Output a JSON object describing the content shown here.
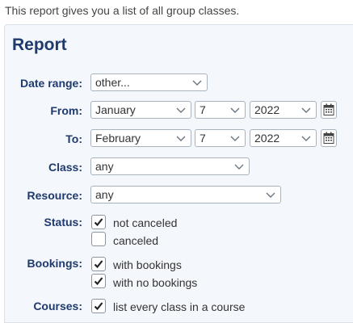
{
  "intro": "This report gives you a list of all group classes.",
  "title": "Report",
  "date_range": {
    "label": "Date range:",
    "value": "other..."
  },
  "from": {
    "label": "From:",
    "month": "January",
    "day": "7",
    "year": "2022"
  },
  "to": {
    "label": "To:",
    "month": "February",
    "day": "7",
    "year": "2022"
  },
  "class": {
    "label": "Class:",
    "value": "any"
  },
  "resource": {
    "label": "Resource:",
    "value": "any"
  },
  "status": {
    "label": "Status:",
    "options": [
      {
        "text": "not canceled",
        "checked": true
      },
      {
        "text": "canceled",
        "checked": false
      }
    ]
  },
  "bookings": {
    "label": "Bookings:",
    "options": [
      {
        "text": "with bookings",
        "checked": true
      },
      {
        "text": "with no bookings",
        "checked": true
      }
    ]
  },
  "courses": {
    "label": "Courses:",
    "options": [
      {
        "text": "list every class in a course",
        "checked": true
      }
    ]
  },
  "colors": {
    "label": "#1e3a6e",
    "panel": "#f4f7fb",
    "border": "#a9b3bd"
  },
  "icons": {
    "dropdown": "chevron-down-icon",
    "calendar": "calendar-icon",
    "check": "checkmark-icon"
  }
}
